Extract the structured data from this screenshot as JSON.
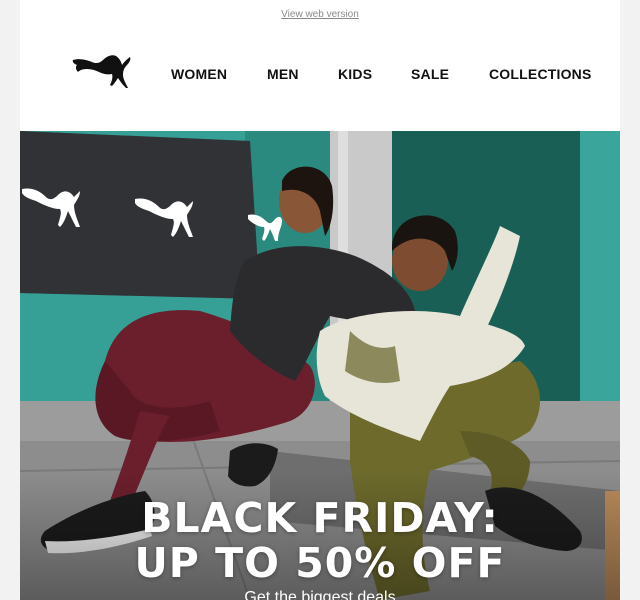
{
  "header": {
    "view_web_link": "View web version",
    "brand": "PUMA",
    "logo_icon": "puma-cat-logo-icon"
  },
  "nav": {
    "items": [
      {
        "label": "WOMEN"
      },
      {
        "label": "MEN"
      },
      {
        "label": "KIDS"
      },
      {
        "label": "SALE"
      },
      {
        "label": "COLLECTIONS"
      }
    ]
  },
  "hero": {
    "headline_line1": "BLACK FRIDAY:",
    "headline_line2": "UP TO 50% OFF",
    "subline": "Get the biggest deals"
  },
  "colors": {
    "text_dark": "#111111",
    "link_gray": "#8a8a8a",
    "wall_teal": "#2f8f86",
    "wall_green": "#155a50",
    "sidewalk": "#8f8f8f"
  }
}
